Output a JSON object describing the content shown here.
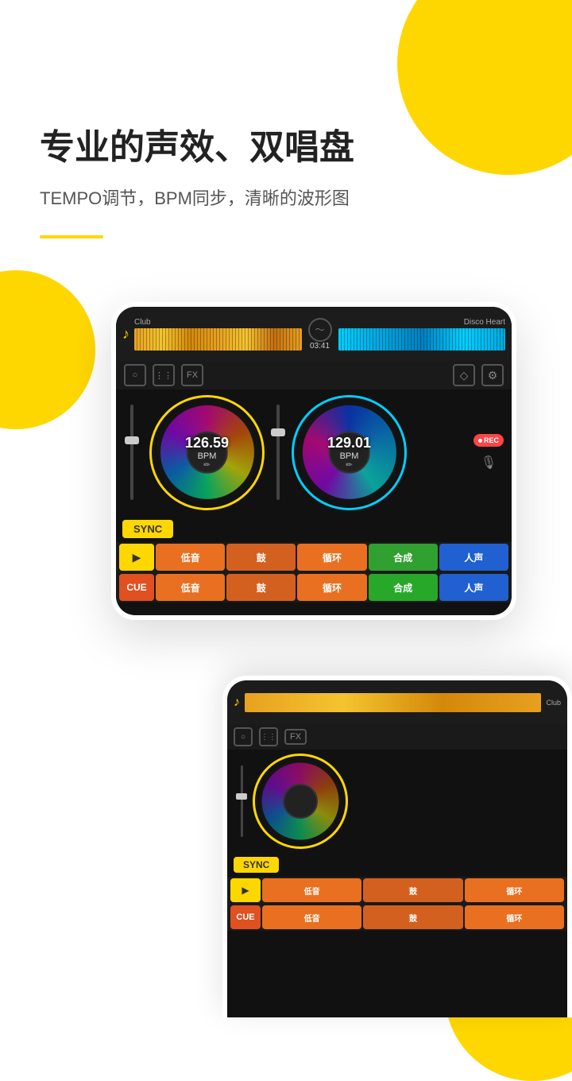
{
  "background": {
    "color": "#ffffff"
  },
  "header": {
    "title": "专业的声效、双唱盘",
    "subtitle": "TEMPO调节，BPM同步，清晰的波形图"
  },
  "dj1": {
    "track_left": "Club",
    "track_right": "Disco Heart",
    "time": "03:41",
    "bpm_left": "126.59",
    "bpm_right": "129.01",
    "bpm_label": "BPM",
    "sync_label": "SYNC",
    "rec_label": "REC",
    "cue_label": "CUE",
    "play_symbol": "▶",
    "pads_row1": [
      "低音",
      "鼓",
      "循环",
      "合成",
      "人声"
    ],
    "pads_row2": [
      "低音",
      "鼓",
      "循环",
      "合成",
      "人声"
    ],
    "fx_label": "FX"
  },
  "dj2": {
    "track_label": "Club",
    "sync_label": "SYNC",
    "cue_label": "CUE",
    "play_symbol": "▶",
    "fx_label": "FX"
  }
}
